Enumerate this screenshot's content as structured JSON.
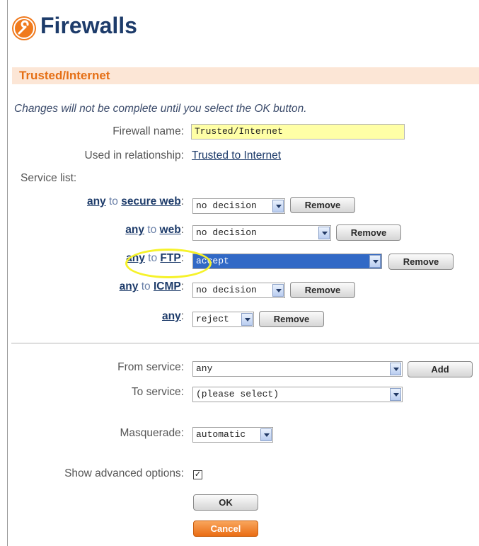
{
  "header": {
    "title": "Firewalls",
    "icon": "wrench-icon"
  },
  "section": {
    "title": "Trusted/Internet"
  },
  "note": "Changes will not be complete until you select the OK button.",
  "firewall_name": {
    "label": "Firewall name:",
    "value": "Trusted/Internet"
  },
  "relationship": {
    "label": "Used in relationship:",
    "link": "Trusted to Internet"
  },
  "service_list": {
    "label": "Service list:",
    "rules": [
      {
        "from": "any",
        "connector": "to",
        "to": "secure web",
        "colon": ":",
        "decision": "no decision",
        "remove": "Remove"
      },
      {
        "from": "any",
        "connector": "to",
        "to": "web",
        "colon": ":",
        "decision": "no decision",
        "remove": "Remove"
      },
      {
        "from": "any",
        "connector": "to",
        "to": "FTP",
        "colon": ":",
        "decision": "accept",
        "remove": "Remove"
      },
      {
        "from": "any",
        "connector": "to",
        "to": "ICMP",
        "colon": ":",
        "decision": "no decision",
        "remove": "Remove"
      },
      {
        "from": "any",
        "connector": "",
        "to": "",
        "colon": ":",
        "decision": "reject",
        "remove": "Remove"
      }
    ]
  },
  "from_service": {
    "label": "From service:",
    "value": "any",
    "add": "Add"
  },
  "to_service": {
    "label": "To service:",
    "value": "(please select)"
  },
  "masquerade": {
    "label": "Masquerade:",
    "value": "automatic"
  },
  "advanced": {
    "label": "Show advanced options:",
    "checked_mark": "✓"
  },
  "buttons": {
    "ok": "OK",
    "cancel": "Cancel"
  },
  "colors": {
    "accent": "#e56f15",
    "title": "#1d3b6a",
    "selection": "#3169c6",
    "highlight_ring": "#f6f22a"
  }
}
